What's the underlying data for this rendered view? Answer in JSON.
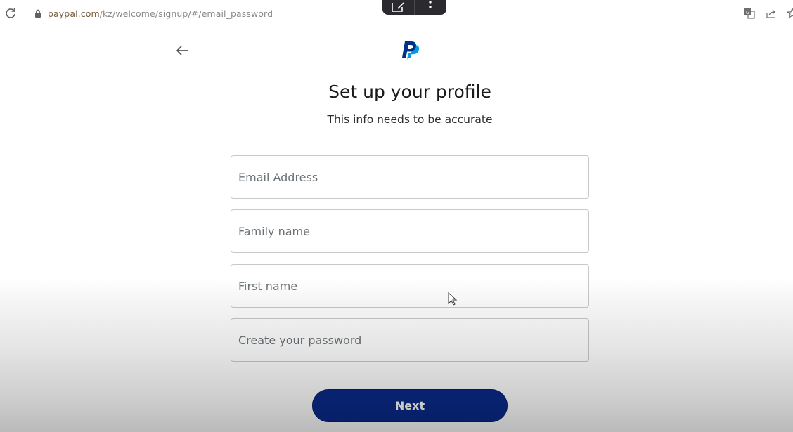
{
  "browser": {
    "url_host": "paypal.com",
    "url_path": "/kz/welcome/signup/#/email_password",
    "icons": [
      "reload-icon",
      "lock-icon",
      "open-external-icon",
      "more-vertical-icon",
      "translate-icon",
      "share-icon",
      "star-icon"
    ]
  },
  "page": {
    "back_icon": "arrow-left-icon",
    "logo": "paypal-logo",
    "title": "Set up your profile",
    "subtitle": "This info needs to be accurate"
  },
  "form": {
    "fields": [
      {
        "name": "email",
        "placeholder": "Email Address",
        "value": ""
      },
      {
        "name": "family_name",
        "placeholder": "Family name",
        "value": ""
      },
      {
        "name": "first_name",
        "placeholder": "First name",
        "value": ""
      },
      {
        "name": "password",
        "placeholder": "Create your password",
        "value": ""
      }
    ],
    "submit_label": "Next"
  },
  "colors": {
    "brand_dark_blue": "#0a2a8a",
    "logo_dark": "#003087",
    "logo_light": "#009cde"
  }
}
